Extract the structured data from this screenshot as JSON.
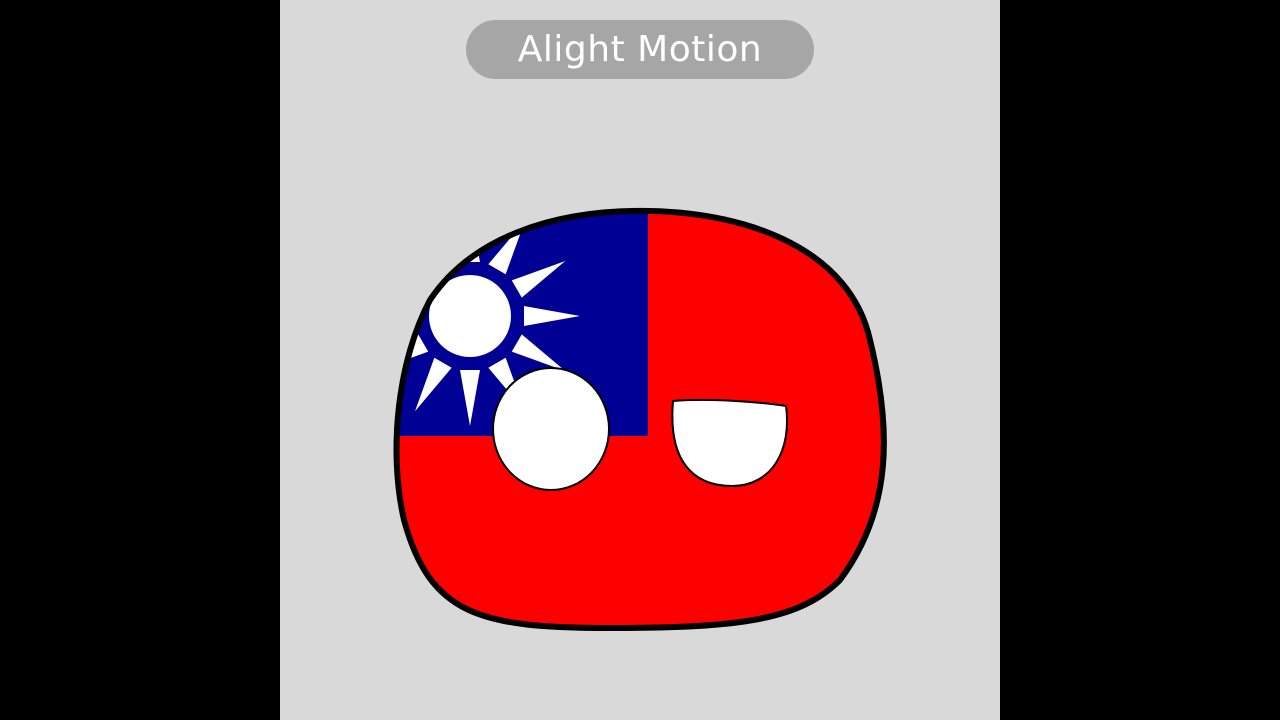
{
  "watermark": {
    "text": "Alight Motion"
  },
  "character": {
    "icon": "countryball-taiwan",
    "colors": {
      "red": "#fe0000",
      "blue": "#000095",
      "white": "#ffffff",
      "outline": "#000000"
    }
  },
  "colors": {
    "letterbox": "#000000",
    "canvas_background": "#d9d9d9",
    "watermark_pill": "#a6a6a6"
  }
}
